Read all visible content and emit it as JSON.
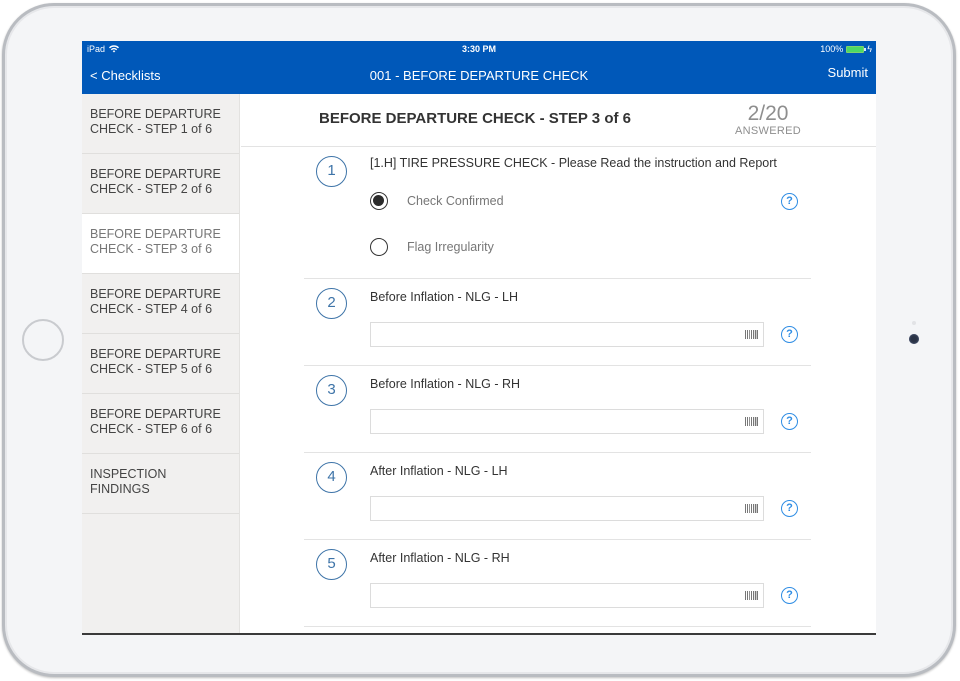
{
  "status_bar": {
    "device": "iPad",
    "time": "3:30 PM",
    "battery": "100%"
  },
  "nav": {
    "back_label": "< Checklists",
    "title": "001 - BEFORE DEPARTURE CHECK",
    "submit_label": "Submit"
  },
  "sidebar": {
    "items": [
      {
        "line1": "BEFORE DEPARTURE",
        "line2": "CHECK - STEP 1 of 6",
        "active": false
      },
      {
        "line1": "BEFORE DEPARTURE",
        "line2": "CHECK - STEP 2 of 6",
        "active": false
      },
      {
        "line1": "BEFORE DEPARTURE",
        "line2": "CHECK - STEP 3 of 6",
        "active": true
      },
      {
        "line1": "BEFORE DEPARTURE",
        "line2": "CHECK - STEP 4 of 6",
        "active": false
      },
      {
        "line1": "BEFORE DEPARTURE",
        "line2": "CHECK - STEP 5 of 6",
        "active": false
      },
      {
        "line1": "BEFORE DEPARTURE",
        "line2": "CHECK - STEP 6 of 6",
        "active": false
      },
      {
        "line1": "INSPECTION",
        "line2": "FINDINGS",
        "active": false
      }
    ]
  },
  "main": {
    "step_title": "BEFORE DEPARTURE CHECK - STEP 3 of 6",
    "answered_count": "2/20",
    "answered_label": "ANSWERED",
    "questions": [
      {
        "number": "1",
        "label": "[1.H] TIRE PRESSURE CHECK - Please Read the instruction and Report",
        "options": [
          {
            "label": "Check Confirmed",
            "selected": true
          },
          {
            "label": "Flag Irregularity",
            "selected": false
          }
        ]
      },
      {
        "number": "2",
        "label": "Before Inflation - NLG - LH",
        "value": "",
        "placeholder": ""
      },
      {
        "number": "3",
        "label": "Before Inflation - NLG - RH",
        "value": "",
        "placeholder": ""
      },
      {
        "number": "4",
        "label": "After Inflation - NLG - LH",
        "value": "",
        "placeholder": ""
      },
      {
        "number": "5",
        "label": "After Inflation - NLG - RH",
        "value": "",
        "placeholder": ""
      }
    ],
    "help_icon": "?"
  },
  "colors": {
    "brand_blue": "#0058b9",
    "accent_blue": "#2f8de4",
    "number_blue": "#3e74a8",
    "sidebar_bg": "#f1f0ef"
  }
}
